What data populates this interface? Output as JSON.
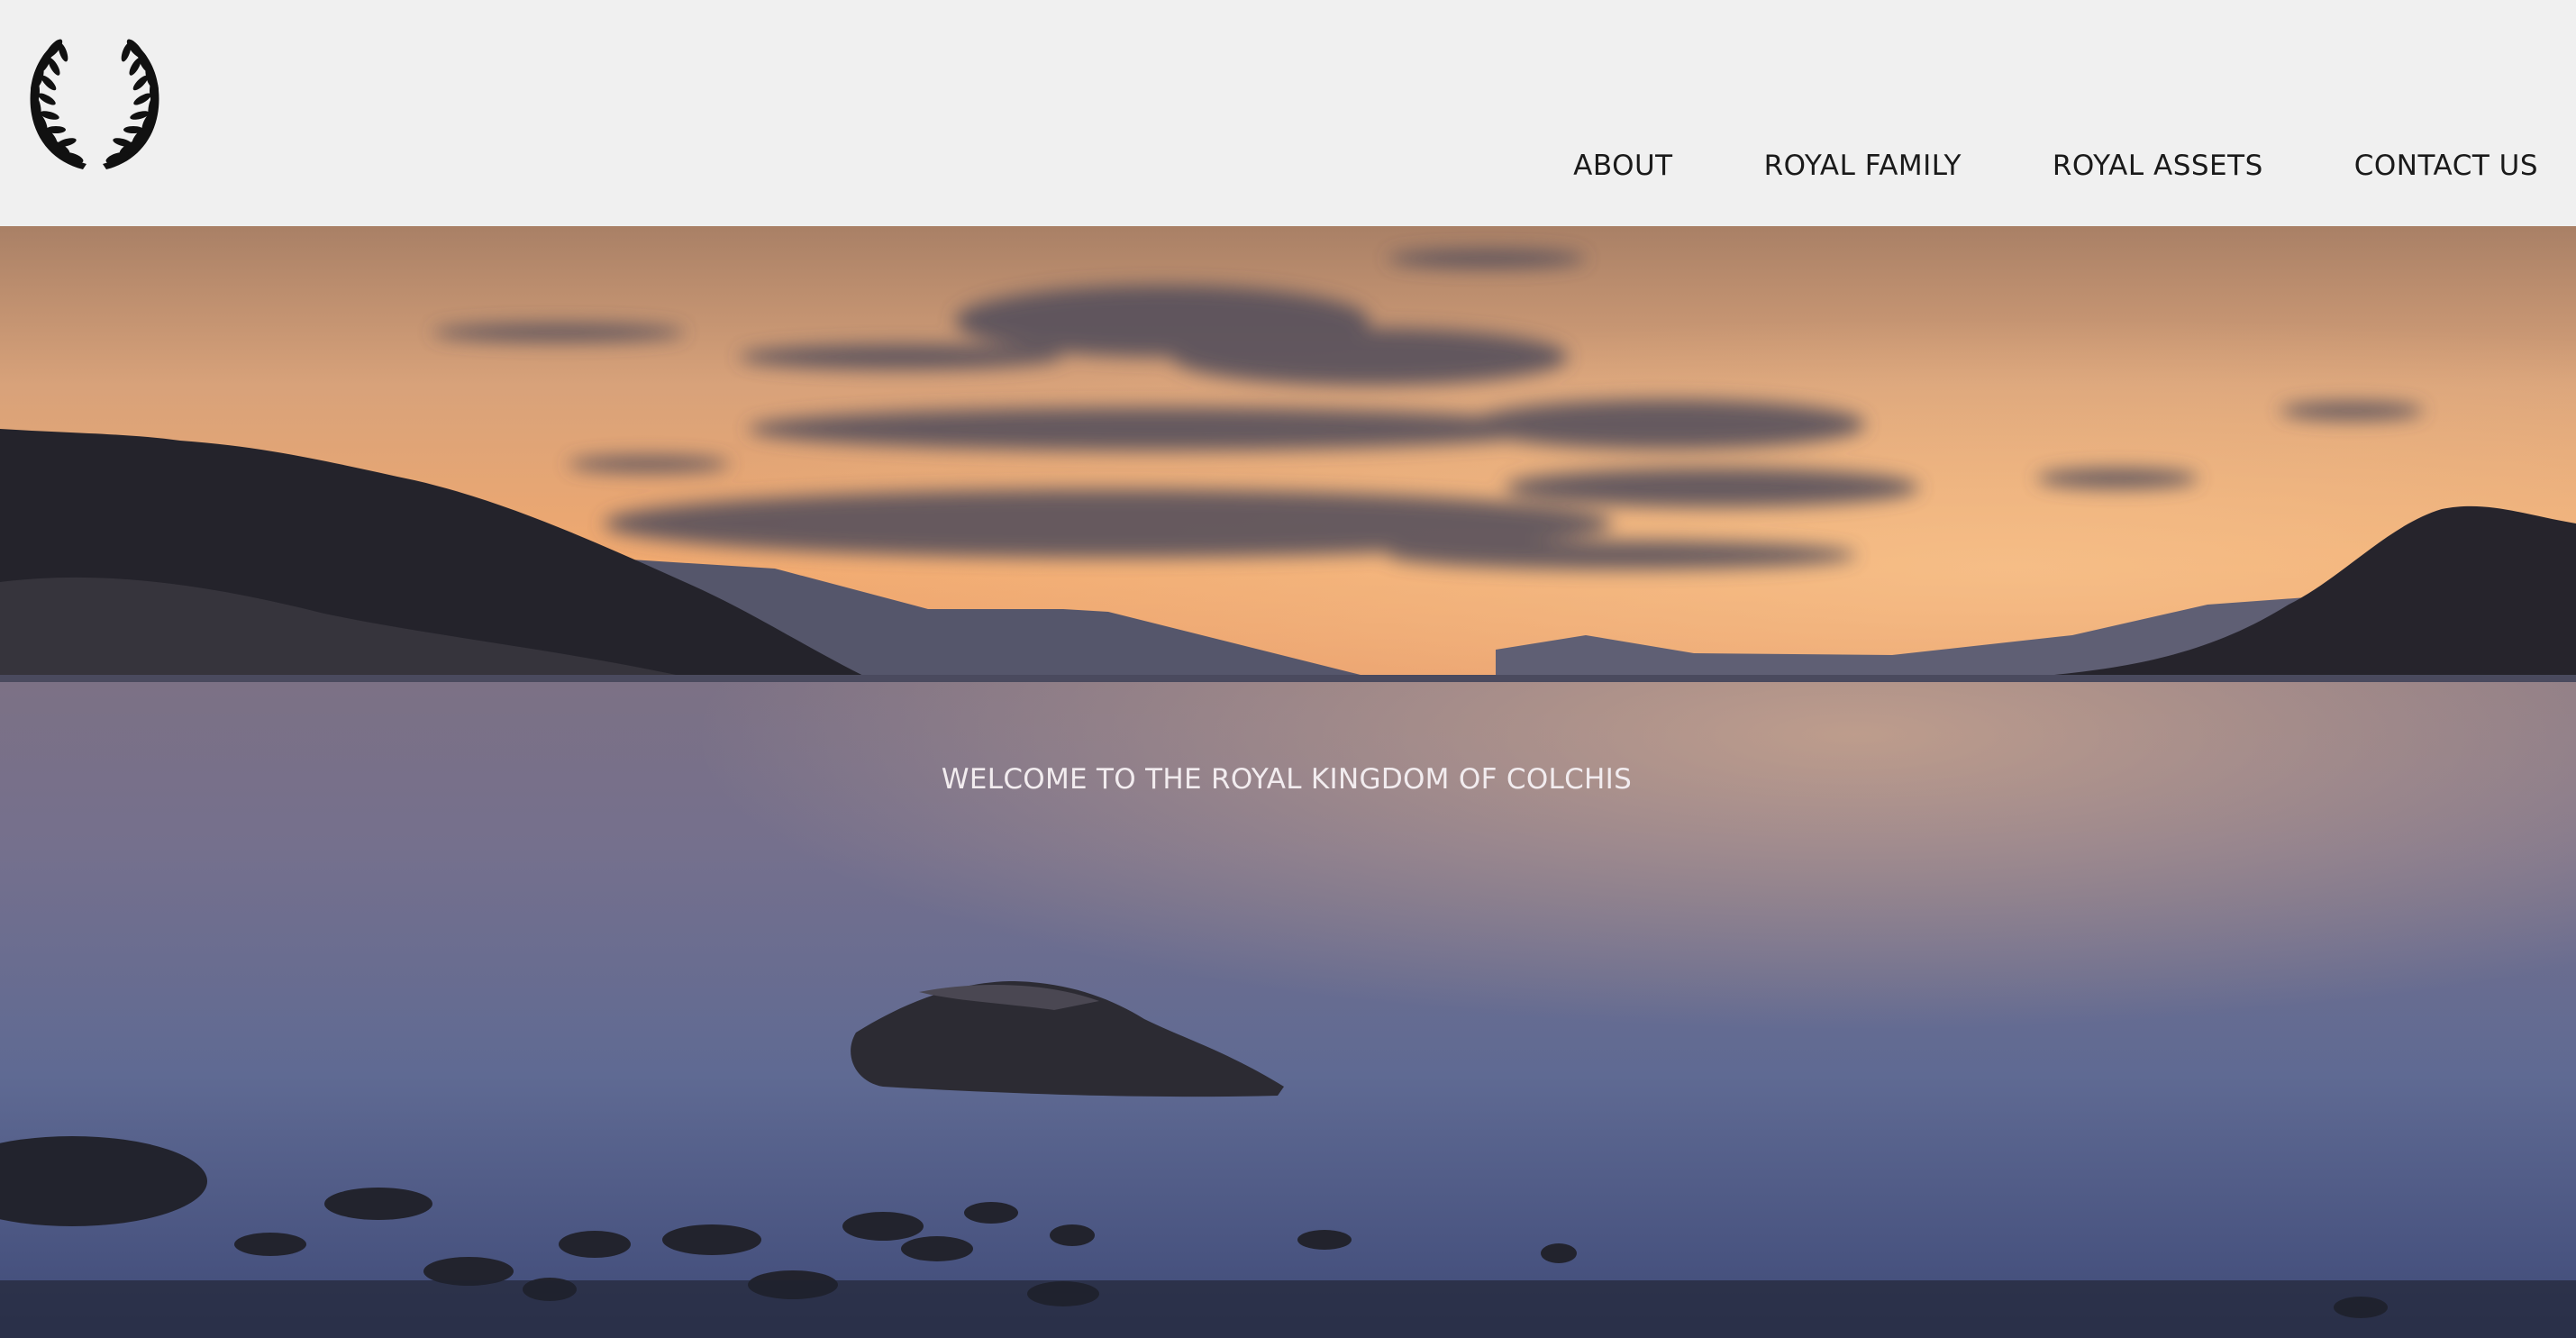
{
  "logo": {
    "icon": "laurel-wreath-icon"
  },
  "nav": {
    "items": [
      {
        "label": "ABOUT"
      },
      {
        "label": "ROYAL FAMILY"
      },
      {
        "label": "ROYAL ASSETS"
      },
      {
        "label": "CONTACT US"
      }
    ]
  },
  "hero": {
    "title": "WELCOME TO THE ROYAL KINGDOM OF COLCHIS"
  },
  "colors": {
    "header_bg": "#f0f0f0",
    "nav_text": "#1a1a1a",
    "hero_text": "#f2ecef",
    "sky_top": "#c49470",
    "sky_horizon": "#f4a86a",
    "water": "#6d6c8e"
  }
}
